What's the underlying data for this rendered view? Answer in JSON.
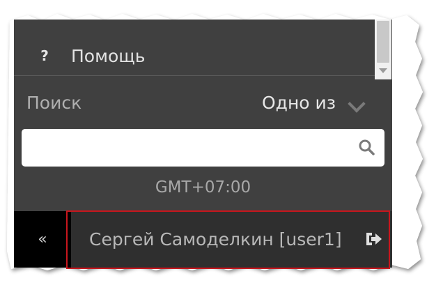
{
  "menu": {
    "help_icon": "question-icon",
    "help_label": "Помощь"
  },
  "search": {
    "label": "Поиск",
    "mode_value": "Одно из",
    "input_value": "",
    "placeholder": ""
  },
  "timezone": "GMT+07:00",
  "footer": {
    "collapse_label": "«",
    "user_label": "Сергей Самоделкин [user1]",
    "logout_icon": "sign-out-icon"
  },
  "colors": {
    "panel_bg": "#404040",
    "user_bar_bg": "#2f2f2f",
    "highlight": "#c8161d"
  }
}
